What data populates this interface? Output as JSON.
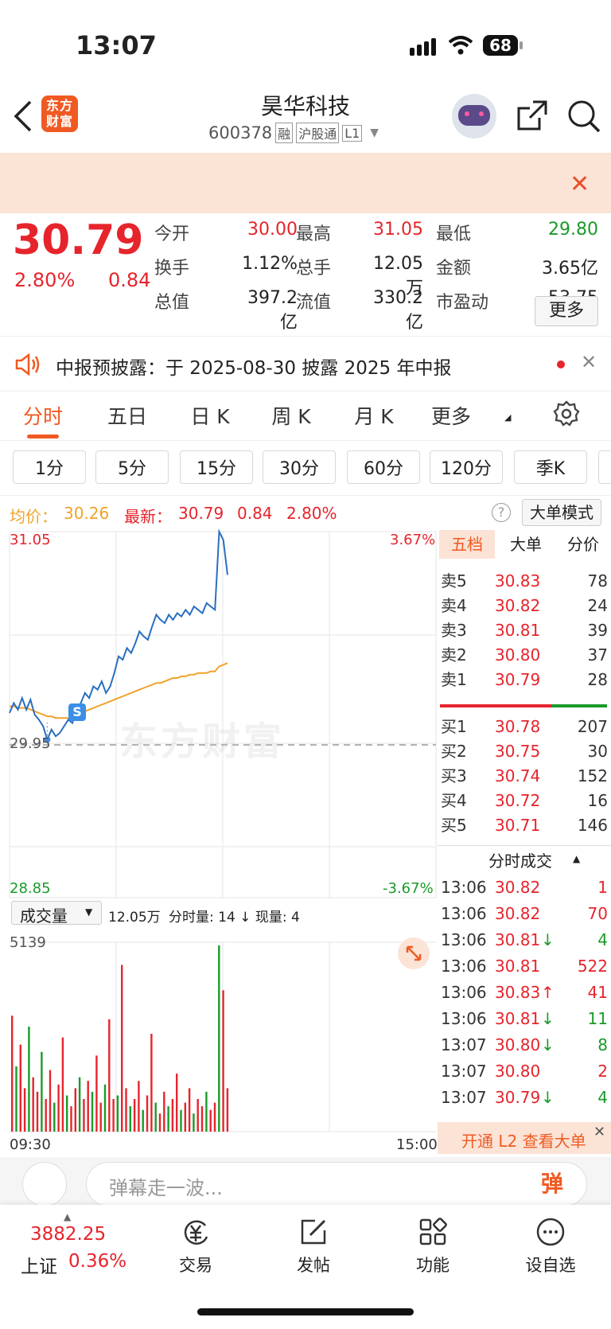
{
  "status": {
    "time": "13:07",
    "battery": "68"
  },
  "header": {
    "logo": "东方财富",
    "title": "昊华科技",
    "code": "600378",
    "badges": [
      "融",
      "沪股通",
      "L1"
    ]
  },
  "quote": {
    "price": "30.79",
    "pct": "2.80%",
    "chg": "0.84",
    "fields": [
      {
        "label": "今开",
        "value": "30.00",
        "color": "#e6242c"
      },
      {
        "label": "最高",
        "value": "31.05",
        "color": "#e6242c"
      },
      {
        "label": "最低",
        "value": "29.80",
        "color": "#1a9a2a"
      },
      {
        "label": "换手",
        "value": "1.12%",
        "color": "#222"
      },
      {
        "label": "总手",
        "value": "12.05万",
        "color": "#222"
      },
      {
        "label": "金额",
        "value": "3.65亿",
        "color": "#222"
      },
      {
        "label": "总值",
        "value": "397.2亿",
        "color": "#222"
      },
      {
        "label": "流值",
        "value": "330.2亿",
        "color": "#222"
      },
      {
        "label": "市盈动",
        "value": "53.75",
        "color": "#222"
      }
    ],
    "more": "更多"
  },
  "notice": {
    "text": "中报预披露：于 2025-08-30 披露 2025 年中报"
  },
  "tabs": [
    "分时",
    "五日",
    "日 K",
    "周 K",
    "月 K",
    "更多"
  ],
  "subtabs": [
    "1分",
    "5分",
    "15分",
    "30分",
    "60分",
    "120分",
    "季K"
  ],
  "info": {
    "avg_label": "均价：",
    "avg": "30.26",
    "last_label": "最新：",
    "last": "30.79",
    "chg": "0.84",
    "pct": "2.80%",
    "mode": "大单模式"
  },
  "chart": {
    "ymax": "31.05",
    "ymin": "28.85",
    "pmax": "3.67%",
    "pmin": "-3.67%",
    "mid": "29.95",
    "watermark": "东方财富",
    "vol_sel": "成交量",
    "vol_total": "12.05万",
    "vol_sub": "分时量: 14 ↓ 现量: 4",
    "vol_max": "5139",
    "t_start": "09:30",
    "t_end": "15:00",
    "marker": "S"
  },
  "chart_data": {
    "type": "line",
    "series": [
      {
        "values": [
          29.96,
          30.02,
          29.98,
          30.05,
          29.98,
          30.04,
          29.95,
          29.92,
          29.88,
          29.8,
          29.86,
          29.82,
          29.84,
          29.88,
          29.92,
          29.9,
          29.98,
          30.02,
          30.08,
          30.05,
          30.12,
          30.1,
          30.15,
          30.08,
          30.12,
          30.2,
          30.3,
          30.28,
          30.35,
          30.32,
          30.38,
          30.45,
          30.42,
          30.4,
          30.48,
          30.55,
          30.52,
          30.5,
          30.55,
          30.52,
          30.56,
          30.54,
          30.58,
          30.55,
          30.6,
          30.58,
          30.56,
          30.62,
          30.6,
          30.58,
          31.05,
          31.0,
          30.79
        ]
      },
      {
        "values": [
          30.0,
          30.0,
          29.99,
          29.99,
          29.99,
          29.98,
          29.97,
          29.96,
          29.95,
          29.94,
          29.94,
          29.93,
          29.93,
          29.93,
          29.93,
          29.94,
          29.95,
          29.96,
          29.97,
          29.98,
          29.99,
          30.0,
          30.01,
          30.02,
          30.03,
          30.04,
          30.05,
          30.06,
          30.07,
          30.08,
          30.09,
          30.1,
          30.11,
          30.12,
          30.13,
          30.14,
          30.14,
          30.15,
          30.16,
          30.17,
          30.17,
          30.18,
          30.18,
          30.19,
          30.19,
          30.2,
          30.2,
          30.2,
          30.21,
          30.21,
          30.24,
          30.25,
          30.26
        ]
      }
    ],
    "ylim": [
      28.85,
      31.05
    ],
    "volumes": [
      3200,
      1800,
      2400,
      1200,
      2900,
      1500,
      1100,
      2200,
      900,
      1700,
      800,
      1300,
      2600,
      1000,
      700,
      1200,
      1500,
      900,
      1400,
      1100,
      2100,
      800,
      1300,
      3100,
      900,
      1000,
      4600,
      1200,
      700,
      900,
      1400,
      600,
      1000,
      2700,
      800,
      500,
      1100,
      700,
      900,
      1600,
      600,
      800,
      1200,
      500,
      900,
      700,
      1100,
      600,
      800,
      5139,
      3900,
      1200
    ],
    "orderbook": {
      "asks": [
        [
          "卖5",
          "30.83",
          "78"
        ],
        [
          "卖4",
          "30.82",
          "24"
        ],
        [
          "卖3",
          "30.81",
          "39"
        ],
        [
          "卖2",
          "30.80",
          "37"
        ],
        [
          "卖1",
          "30.79",
          "28"
        ]
      ],
      "bids": [
        [
          "买1",
          "30.78",
          "207"
        ],
        [
          "买2",
          "30.75",
          "30"
        ],
        [
          "买3",
          "30.74",
          "152"
        ],
        [
          "买4",
          "30.72",
          "16"
        ],
        [
          "买5",
          "30.71",
          "146"
        ]
      ]
    }
  },
  "panel": {
    "tabs": [
      "五档",
      "大单",
      "分价"
    ],
    "trades_title": "分时成交",
    "trades": [
      [
        "13:06",
        "30.82",
        "",
        "1"
      ],
      [
        "13:06",
        "30.82",
        "",
        "70"
      ],
      [
        "13:06",
        "30.81",
        "↓",
        "4"
      ],
      [
        "13:06",
        "30.81",
        "",
        "522"
      ],
      [
        "13:06",
        "30.83",
        "↑",
        "41"
      ],
      [
        "13:06",
        "30.81",
        "↓",
        "11"
      ],
      [
        "13:07",
        "30.80",
        "↓",
        "8"
      ],
      [
        "13:07",
        "30.80",
        "",
        "2"
      ],
      [
        "13:07",
        "30.79",
        "↓",
        "4"
      ]
    ],
    "l2": "开通 L2 查看大单"
  },
  "input": {
    "placeholder": "弹幕走一波...",
    "danmu": "弹"
  },
  "bottom": {
    "index_value": "3882.25",
    "index_name": "上证",
    "index_pct": "0.36%",
    "items": [
      "交易",
      "发帖",
      "功能",
      "设自选"
    ]
  }
}
